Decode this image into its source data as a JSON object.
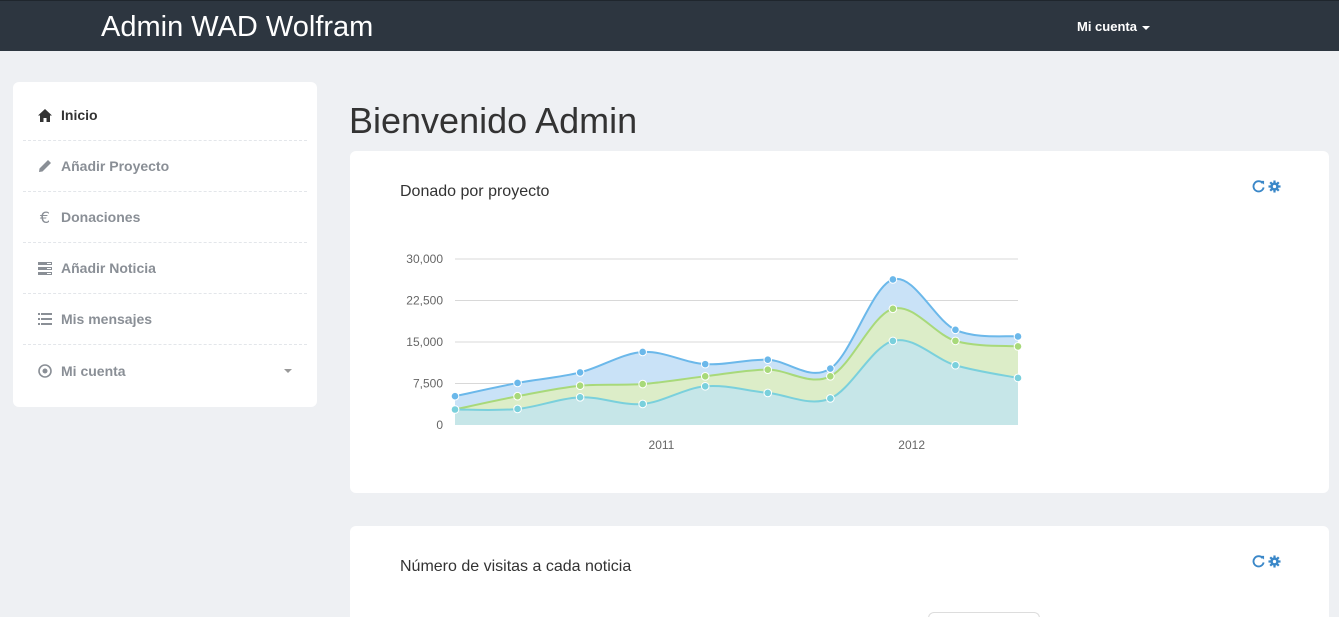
{
  "app": {
    "brand": "Admin WAD Wolfram",
    "account_label": "Mi cuenta"
  },
  "sidebar": {
    "items": [
      {
        "label": "Inicio",
        "icon": "home-icon",
        "active": true
      },
      {
        "label": "Añadir Proyecto",
        "icon": "pencil-icon"
      },
      {
        "label": "Donaciones",
        "icon": "euro-icon"
      },
      {
        "label": "Añadir Noticia",
        "icon": "tasks-icon"
      },
      {
        "label": "Mis mensajes",
        "icon": "list-icon"
      },
      {
        "label": "Mi cuenta",
        "icon": "record-icon",
        "has_dropdown": true
      }
    ]
  },
  "main": {
    "title": "Bienvenido Admin",
    "panels": [
      {
        "title": "Donado por proyecto",
        "tools": [
          "refresh-icon",
          "settings-icon"
        ]
      },
      {
        "title": "Número de visitas a cada noticia",
        "tools": [
          "refresh-icon",
          "settings-icon"
        ]
      }
    ]
  },
  "colors": {
    "topbar": "#2d3640",
    "series_a": "#6bb8ea",
    "series_b": "#a8d97a",
    "series_c": "#7ad0dc",
    "tool": "#3a87c8"
  },
  "chart_data": {
    "type": "area",
    "title": "",
    "xlabel": "",
    "ylabel": "",
    "ylim": [
      0,
      30000
    ],
    "yticks": [
      "0",
      "7,500",
      "15,000",
      "22,500",
      "30,000"
    ],
    "xticks": [
      "2011",
      "2012"
    ],
    "grid": true,
    "legend": "none",
    "x": [
      0,
      1,
      2,
      3,
      4,
      5,
      6,
      7,
      8,
      9
    ],
    "series": [
      {
        "values": [
          5200,
          7600,
          9500,
          13200,
          11000,
          11800,
          10200,
          26300,
          17200,
          16000
        ]
      },
      {
        "values": [
          2800,
          5200,
          7100,
          7400,
          8800,
          10000,
          8800,
          21000,
          15200,
          14200
        ]
      },
      {
        "values": [
          2800,
          2900,
          5000,
          3800,
          7000,
          5800,
          4800,
          15200,
          10800,
          8500
        ]
      }
    ]
  }
}
